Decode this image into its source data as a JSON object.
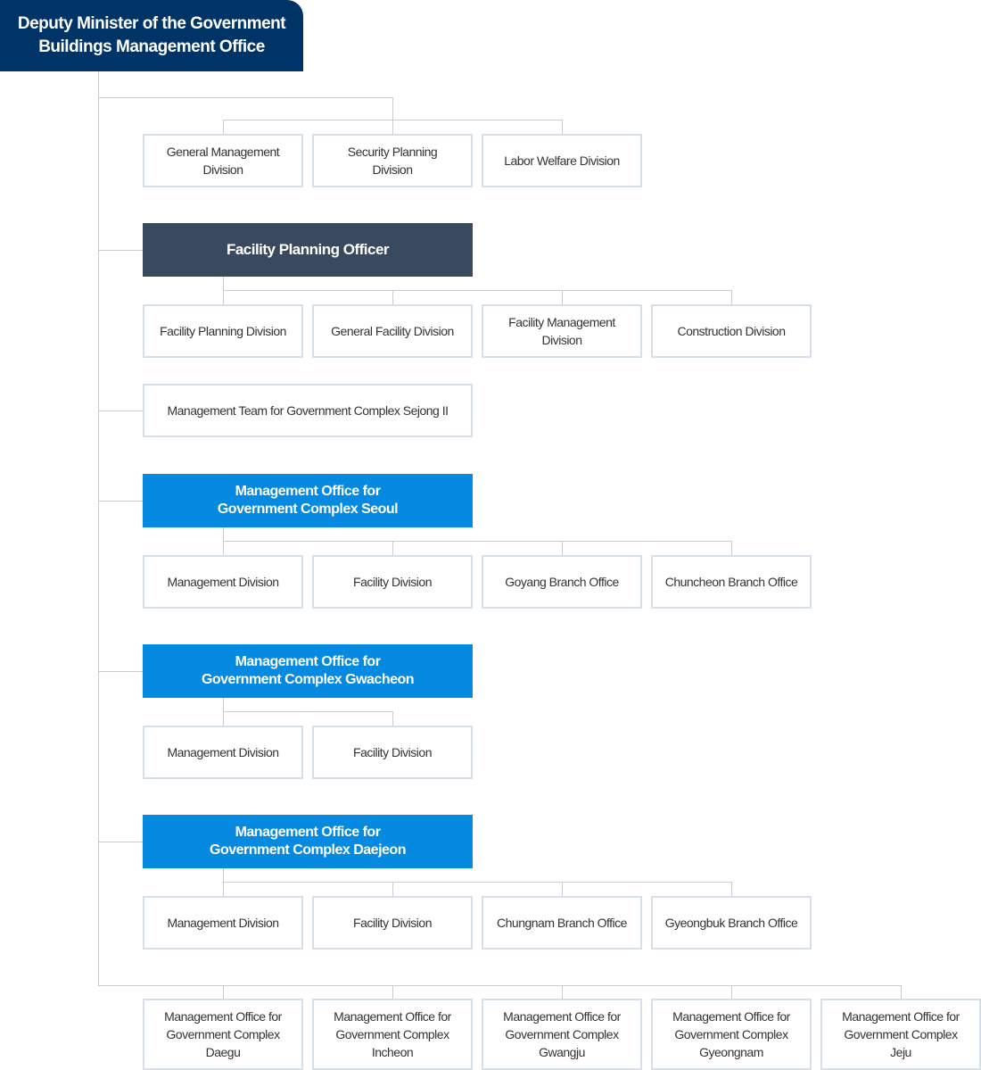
{
  "top": {
    "line1": "Deputy Minister of the Government",
    "line2": "Buildings Management Office"
  },
  "direct_divisions": [
    {
      "line1": "General Management",
      "line2": "Division"
    },
    {
      "line1": "Security Planning",
      "line2": "Division"
    },
    {
      "line1": "Labor Welfare Division",
      "line2": ""
    }
  ],
  "facility_planning": {
    "title": "Facility Planning Officer",
    "divisions": [
      {
        "line1": "Facility Planning Division",
        "line2": ""
      },
      {
        "line1": "General Facility Division",
        "line2": ""
      },
      {
        "line1": "Facility Management",
        "line2": "Division"
      },
      {
        "line1": "Construction Division",
        "line2": ""
      }
    ]
  },
  "sejong_team": {
    "label": "Management Team for Government Complex Sejong II"
  },
  "seoul": {
    "line1": "Management Office for",
    "line2": "Government Complex Seoul",
    "divisions": [
      "Management Division",
      "Facility Division",
      "Goyang Branch Office",
      "Chuncheon Branch Office"
    ]
  },
  "gwacheon": {
    "line1": "Management Office for",
    "line2": "Government Complex Gwacheon",
    "divisions": [
      "Management Division",
      "Facility Division"
    ]
  },
  "daejeon": {
    "line1": "Management Office for",
    "line2": "Government Complex Daejeon",
    "divisions": [
      "Management Division",
      "Facility Division",
      "Chungnam Branch Office",
      "Gyeongbuk Branch Office"
    ]
  },
  "regional_offices": [
    {
      "line1": "Management Office for",
      "line2": "Government Complex",
      "line3": "Daegu"
    },
    {
      "line1": "Management Office for",
      "line2": "Government Complex",
      "line3": "Incheon"
    },
    {
      "line1": "Management Office for",
      "line2": "Government Complex",
      "line3": "Gwangju"
    },
    {
      "line1": "Management Office for",
      "line2": "Government Complex",
      "line3": "Gyeongnam"
    },
    {
      "line1": "Management Office for",
      "line2": "Government Complex",
      "line3": "Jeju"
    }
  ],
  "colors": {
    "top": "#003366",
    "officer": "#394a5e",
    "office": "#0689e1",
    "border": "#d7dfe8",
    "line": "#cccccc"
  }
}
